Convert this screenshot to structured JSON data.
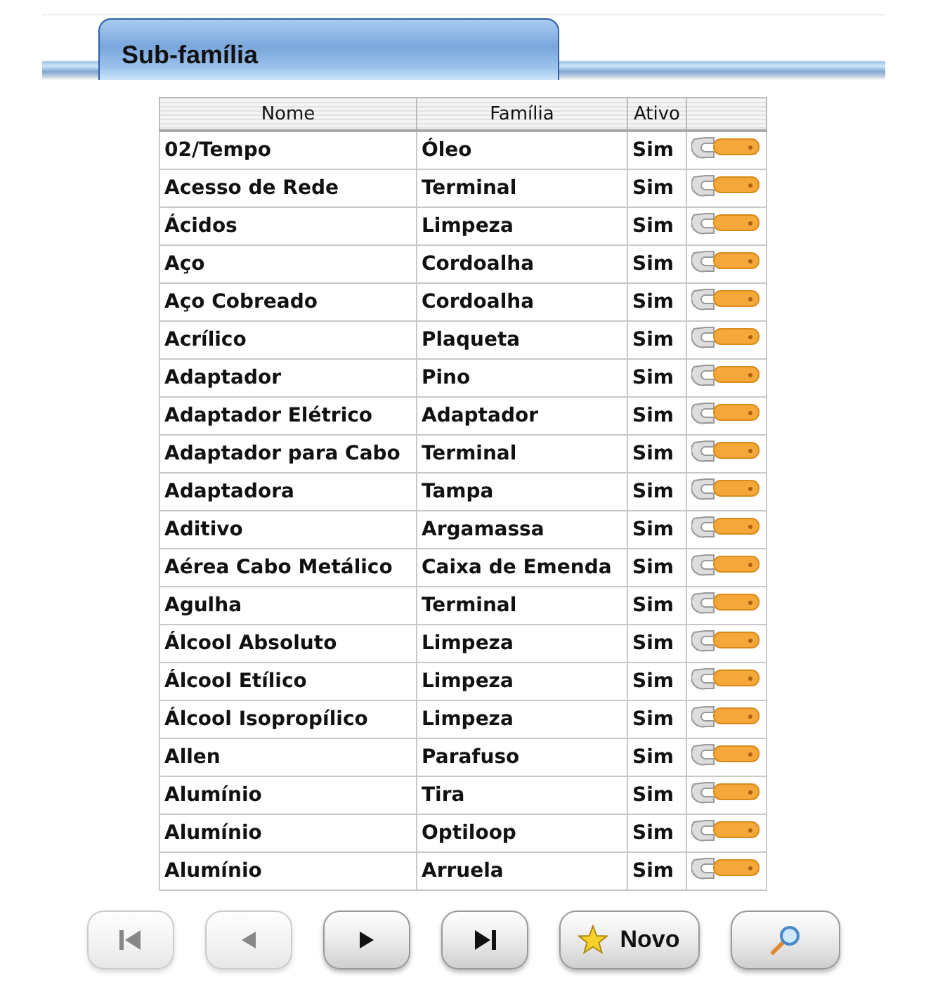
{
  "tab": {
    "title": "Sub-família"
  },
  "table": {
    "columns": [
      "Nome",
      "Família",
      "Ativo"
    ],
    "rows": [
      {
        "nome": "02/Tempo",
        "familia": "Óleo",
        "ativo": "Sim"
      },
      {
        "nome": "Acesso de Rede",
        "familia": "Terminal",
        "ativo": "Sim"
      },
      {
        "nome": "Ácidos",
        "familia": "Limpeza",
        "ativo": "Sim"
      },
      {
        "nome": "Aço",
        "familia": "Cordoalha",
        "ativo": "Sim"
      },
      {
        "nome": "Aço Cobreado",
        "familia": "Cordoalha",
        "ativo": "Sim"
      },
      {
        "nome": "Acrílico",
        "familia": "Plaqueta",
        "ativo": "Sim"
      },
      {
        "nome": "Adaptador",
        "familia": "Pino",
        "ativo": "Sim"
      },
      {
        "nome": "Adaptador Elétrico",
        "familia": "Adaptador",
        "ativo": "Sim"
      },
      {
        "nome": "Adaptador para Cabo",
        "familia": "Terminal",
        "ativo": "Sim"
      },
      {
        "nome": "Adaptadora",
        "familia": "Tampa",
        "ativo": "Sim"
      },
      {
        "nome": "Aditivo",
        "familia": "Argamassa",
        "ativo": "Sim"
      },
      {
        "nome": "Aérea Cabo Metálico",
        "familia": "Caixa de Emenda",
        "ativo": "Sim"
      },
      {
        "nome": "Agulha",
        "familia": "Terminal",
        "ativo": "Sim"
      },
      {
        "nome": "Álcool Absoluto",
        "familia": "Limpeza",
        "ativo": "Sim"
      },
      {
        "nome": "Álcool Etílico",
        "familia": "Limpeza",
        "ativo": "Sim"
      },
      {
        "nome": "Álcool Isopropílico",
        "familia": "Limpeza",
        "ativo": "Sim"
      },
      {
        "nome": "Allen",
        "familia": "Parafuso",
        "ativo": "Sim"
      },
      {
        "nome": "Alumínio",
        "familia": "Tira",
        "ativo": "Sim"
      },
      {
        "nome": "Alumínio",
        "familia": "Optiloop",
        "ativo": "Sim"
      },
      {
        "nome": "Alumínio",
        "familia": "Arruela",
        "ativo": "Sim"
      }
    ]
  },
  "nav": [
    {
      "kind": "first",
      "disabled": true
    },
    {
      "kind": "prev",
      "disabled": true
    },
    {
      "kind": "next",
      "disabled": false
    },
    {
      "kind": "last",
      "disabled": false
    },
    {
      "kind": "new",
      "label": "Novo",
      "disabled": false
    },
    {
      "kind": "search",
      "disabled": false
    }
  ]
}
